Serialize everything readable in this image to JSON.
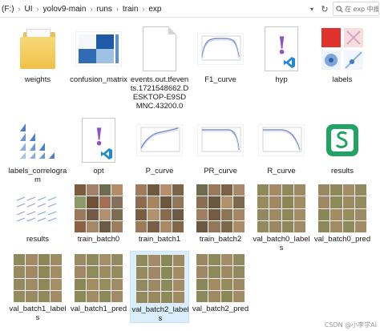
{
  "breadcrumb": {
    "segments": [
      "(F:)",
      "UI",
      "yolov9-main",
      "runs",
      "train",
      "exp"
    ],
    "separator": "›"
  },
  "search": {
    "placeholder": "在 exp 中搜索"
  },
  "files": [
    {
      "name": "weights",
      "kind": "folder"
    },
    {
      "name": "confusion_matrix",
      "kind": "matrix-image"
    },
    {
      "name": "events.out.tfevents.1721548662.DESKTOP-E9SDMNC.43200.0",
      "kind": "document"
    },
    {
      "name": "F1_curve",
      "kind": "curve-image"
    },
    {
      "name": "hyp",
      "kind": "yaml-document"
    },
    {
      "name": "labels",
      "kind": "labels-image"
    },
    {
      "name": "labels_correlogram",
      "kind": "correlogram-image"
    },
    {
      "name": "opt",
      "kind": "yaml-document"
    },
    {
      "name": "P_curve",
      "kind": "curve-image"
    },
    {
      "name": "PR_curve",
      "kind": "curve-image"
    },
    {
      "name": "R_curve",
      "kind": "curve-image"
    },
    {
      "name": "results",
      "kind": "spreadsheet"
    },
    {
      "name": "results",
      "kind": "results-image"
    },
    {
      "name": "train_batch0",
      "kind": "mosaic-image"
    },
    {
      "name": "train_batch1",
      "kind": "mosaic-image"
    },
    {
      "name": "train_batch2",
      "kind": "mosaic-image"
    },
    {
      "name": "val_batch0_labels",
      "kind": "farm-image"
    },
    {
      "name": "val_batch0_pred",
      "kind": "farm-image"
    },
    {
      "name": "val_batch1_labels",
      "kind": "farm-image"
    },
    {
      "name": "val_batch1_pred",
      "kind": "farm-image"
    },
    {
      "name": "val_batch2_labels",
      "kind": "farm-image",
      "selected": true
    },
    {
      "name": "val_batch2_pred",
      "kind": "farm-image"
    }
  ],
  "watermark": "CSDN @小李学AI",
  "colors": {
    "folder": "#f0c04a",
    "yaml_mark": "#8c52c6",
    "spreadsheet": "#21a366",
    "selection": "#dbeefb"
  }
}
